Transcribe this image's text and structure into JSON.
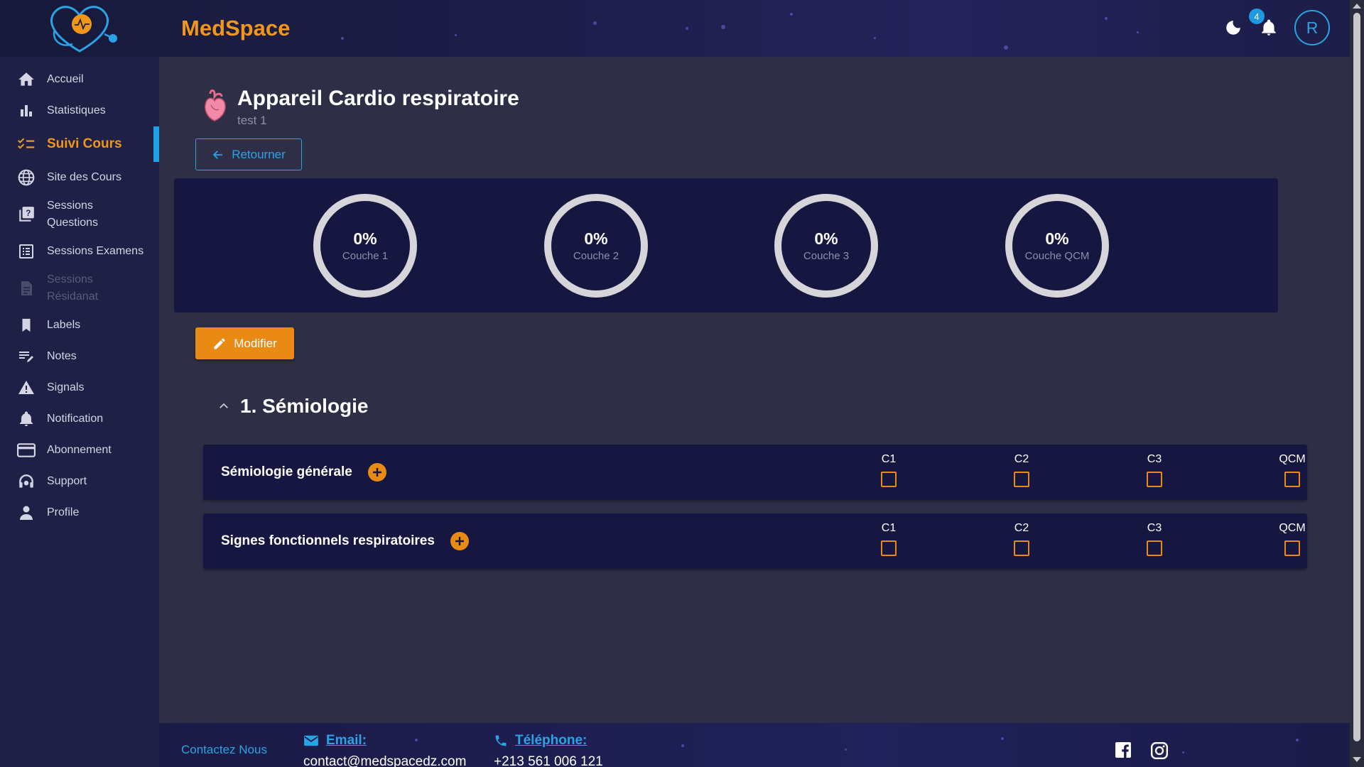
{
  "header": {
    "brand": "MedSpace",
    "notification_count": "4",
    "avatar_initial": "R"
  },
  "sidebar": {
    "items": [
      {
        "label": "Accueil",
        "icon": "home-icon"
      },
      {
        "label": "Statistiques",
        "icon": "bar-chart-icon"
      },
      {
        "label": "Suivi Cours",
        "icon": "checklist-icon",
        "active": true
      },
      {
        "label": "Site des Cours",
        "icon": "globe-icon"
      },
      {
        "label": "Sessions Questions",
        "icon": "question-book-icon"
      },
      {
        "label": "Sessions Examens",
        "icon": "list-icon"
      },
      {
        "label": "Sessions Résidanat",
        "icon": "document-icon",
        "disabled": true
      },
      {
        "label": "Labels",
        "icon": "bookmark-icon"
      },
      {
        "label": "Notes",
        "icon": "edit-note-icon"
      },
      {
        "label": "Signals",
        "icon": "warning-icon"
      },
      {
        "label": "Notification",
        "icon": "bell-icon"
      },
      {
        "label": "Abonnement",
        "icon": "credit-card-icon"
      },
      {
        "label": "Support",
        "icon": "support-icon"
      },
      {
        "label": "Profile",
        "icon": "person-icon"
      }
    ]
  },
  "page": {
    "title": "Appareil Cardio respiratoire",
    "subtitle": "test 1",
    "back_label": "Retourner",
    "modify_label": "Modifier"
  },
  "progress": [
    {
      "value": "0%",
      "label": "Couche 1",
      "fraction": 0
    },
    {
      "value": "0%",
      "label": "Couche 2",
      "fraction": 0
    },
    {
      "value": "0%",
      "label": "Couche 3",
      "fraction": 0
    },
    {
      "value": "0%",
      "label": "Couche QCM",
      "fraction": 0
    }
  ],
  "section": {
    "title": "1. Sémiologie",
    "courses": [
      {
        "name": "Sémiologie générale",
        "columns": [
          "C1",
          "C2",
          "C3",
          "QCM"
        ],
        "checked": [
          false,
          false,
          false,
          false
        ]
      },
      {
        "name": "Signes fonctionnels respiratoires",
        "columns": [
          "C1",
          "C2",
          "C3",
          "QCM"
        ],
        "checked": [
          false,
          false,
          false,
          false
        ]
      }
    ]
  },
  "footer": {
    "contact_label": "Contactez Nous",
    "email_label": "Email:",
    "email_value": "contact@medspacedz.com",
    "phone_label": "Téléphone:",
    "phone_value": "+213 561 006 121"
  },
  "colors": {
    "accent": "#f0961a",
    "link": "#2aa3e6",
    "panel": "#151741",
    "sidebar": "#1e2045"
  }
}
